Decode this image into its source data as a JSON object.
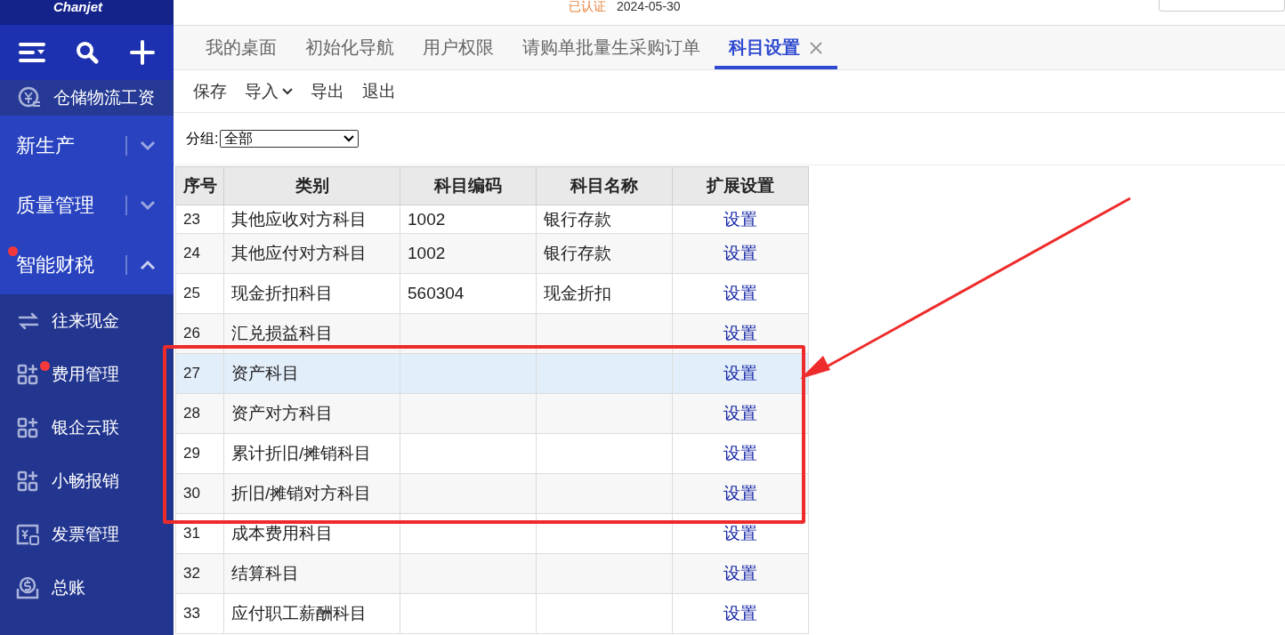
{
  "header": {
    "logo": "Chanjet",
    "verified": "已认证",
    "date": "2024-05-30"
  },
  "sidebar": {
    "top_item": "仓储物流工资",
    "groups": [
      {
        "label": "新生产",
        "expanded": false,
        "badge": false
      },
      {
        "label": "质量管理",
        "expanded": false,
        "badge": false
      },
      {
        "label": "智能财税",
        "expanded": true,
        "badge": true
      }
    ],
    "items": [
      {
        "label": "往来现金",
        "kind": "arrows",
        "badge": false
      },
      {
        "label": "费用管理",
        "kind": "apps",
        "badge": true
      },
      {
        "label": "银企云联",
        "kind": "apps",
        "badge": false
      },
      {
        "label": "小畅报销",
        "kind": "apps",
        "badge": false
      },
      {
        "label": "发票管理",
        "kind": "invoice",
        "badge": false
      },
      {
        "label": "总账",
        "kind": "ledger",
        "badge": false
      }
    ]
  },
  "tabs": [
    {
      "label": "我的桌面",
      "selected": false,
      "closable": false
    },
    {
      "label": "初始化导航",
      "selected": false,
      "closable": false
    },
    {
      "label": "用户权限",
      "selected": false,
      "closable": false
    },
    {
      "label": "请购单批量生采购订单",
      "selected": false,
      "closable": false
    },
    {
      "label": "科目设置",
      "selected": true,
      "closable": true
    }
  ],
  "toolbar": [
    {
      "label": "保存",
      "dropdown": false
    },
    {
      "label": "导入",
      "dropdown": true
    },
    {
      "label": "导出",
      "dropdown": false
    },
    {
      "label": "退出",
      "dropdown": false
    }
  ],
  "filter": {
    "label": "分组:",
    "value": "全部"
  },
  "table": {
    "columns": [
      "序号",
      "类别",
      "科目编码",
      "科目名称",
      "扩展设置"
    ],
    "rows": [
      {
        "cells": [
          "23",
          "其他应收对方科目",
          "1002",
          "银行存款",
          "设置"
        ],
        "selected": false
      },
      {
        "cells": [
          "24",
          "其他应付对方科目",
          "1002",
          "银行存款",
          "设置"
        ],
        "selected": false
      },
      {
        "cells": [
          "25",
          "现金折扣科目",
          "560304",
          "现金折扣",
          "设置"
        ],
        "selected": false
      },
      {
        "cells": [
          "26",
          "汇兑损益科目",
          "",
          "",
          "设置"
        ],
        "selected": false
      },
      {
        "cells": [
          "27",
          "资产科目",
          "",
          "",
          "设置"
        ],
        "selected": true
      },
      {
        "cells": [
          "28",
          "资产对方科目",
          "",
          "",
          "设置"
        ],
        "selected": false
      },
      {
        "cells": [
          "29",
          "累计折旧/摊销科目",
          "",
          "",
          "设置"
        ],
        "selected": false
      },
      {
        "cells": [
          "30",
          "折旧/摊销对方科目",
          "",
          "",
          "设置"
        ],
        "selected": false
      },
      {
        "cells": [
          "31",
          "成本费用科目",
          "",
          "",
          "设置"
        ],
        "selected": false
      },
      {
        "cells": [
          "32",
          "结算科目",
          "",
          "",
          "设置"
        ],
        "selected": false
      },
      {
        "cells": [
          "33",
          "应付职工薪酬科目",
          "",
          "",
          "设置"
        ],
        "selected": false
      }
    ]
  }
}
